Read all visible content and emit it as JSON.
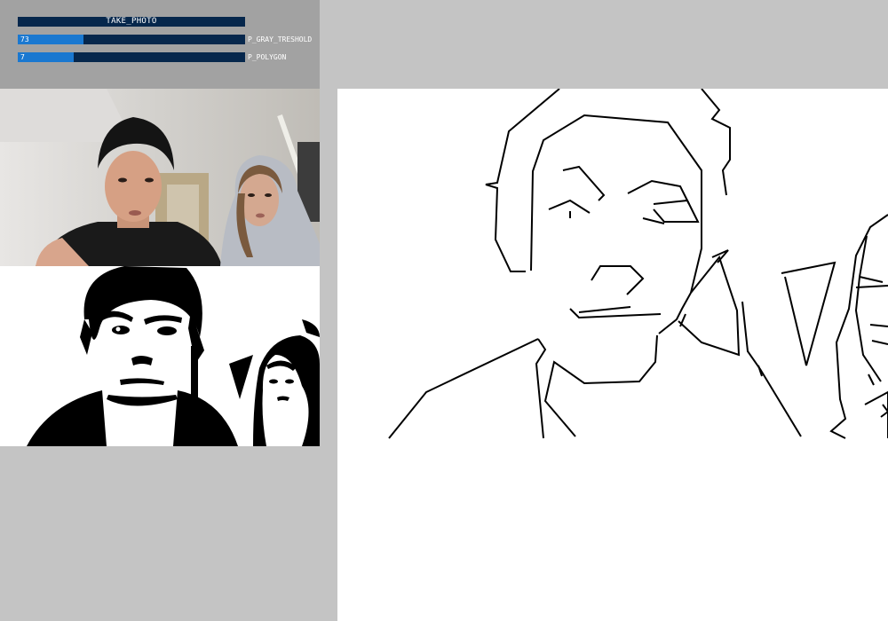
{
  "controls": {
    "take_photo": {
      "label": "TAKE_PHOTO"
    },
    "sliders": [
      {
        "name": "P_GRAY_TRESHOLD",
        "value": "73",
        "fraction": 0.29
      },
      {
        "name": "P_POLYGON",
        "value": "7",
        "fraction": 0.245
      }
    ]
  },
  "colors": {
    "background": "#c4c4c4",
    "control_panel": "#a2a2a2",
    "control_dark": "#06274c",
    "control_active": "#1a78d0",
    "canvas": "#ffffff",
    "stroke": "#000000"
  }
}
